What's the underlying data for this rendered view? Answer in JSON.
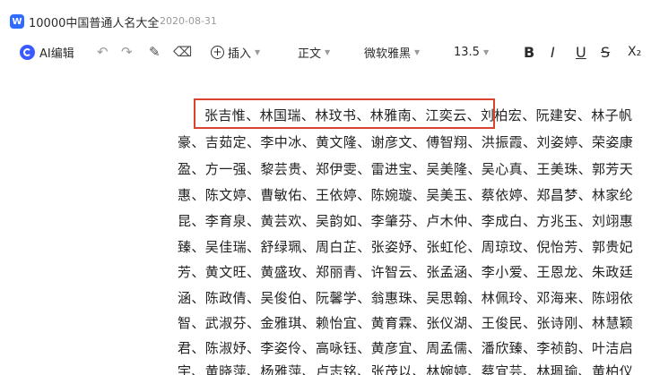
{
  "titlebar": {
    "icon_letter": "W",
    "title": "10000中国普通人名大全",
    "date": "2020-08-31"
  },
  "toolbar": {
    "ai_label": "AI编辑",
    "insert_label": "插入",
    "style_label": "正文",
    "font_label": "微软雅黑",
    "size_label": "13.5",
    "bold": "B",
    "italic": "I",
    "underline": "U",
    "strike": "S",
    "subscript": "X₂",
    "undo": "↶",
    "redo": "↷",
    "brush": "✎",
    "eraser": "⌫"
  },
  "document": {
    "lines": [
      "张吉惟、林国瑞、林玟书、林雅南、江奕云、刘柏宏、阮建安、林子帆",
      "豪、吉茹定、李中冰、黄文隆、谢彦文、傅智翔、洪振霞、刘姿婷、荣姿康",
      "盈、方一强、黎芸贵、郑伊雯、雷进宝、吴美隆、吴心真、王美珠、郭芳天",
      "惠、陈文婷、曹敏佑、王依婷、陈婉璇、吴美玉、蔡依婷、郑昌梦、林家纶",
      "昆、李育泉、黄芸欢、吴韵如、李肇芬、卢木仲、李成白、方兆玉、刘翊惠",
      "臻、吴佳瑞、舒绿珮、周白芷、张姿妤、张虹伦、周琼玟、倪怡芳、郭贵妃",
      "芳、黄文旺、黄盛玫、郑丽青、许智云、张孟涵、李小爱、王恩龙、朱政廷",
      "涵、陈政倩、吴俊伯、阮馨学、翁惠珠、吴思翰、林佩玲、邓海来、陈翊依",
      "智、武淑芬、金雅琪、赖怡宜、黄育霖、张仪湖、王俊民、张诗刚、林慧颖",
      "君、陈淑妤、李姿伶、高咏钰、黄彦宜、周孟儒、潘欣臻、李祯韵、叶洁启",
      "宇、黄晓萍、杨雅萍、卢志铭、张茂以、林婉婷、蔡宜芸、林珮瑜、黄柏仪"
    ]
  }
}
